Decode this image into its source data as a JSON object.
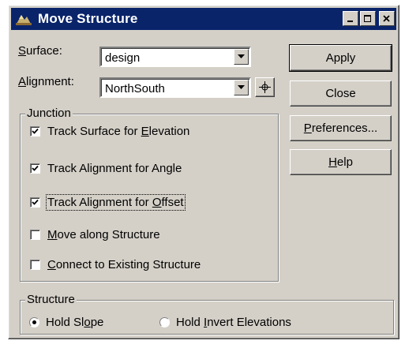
{
  "window": {
    "title": "Move Structure",
    "icon": "app-icon"
  },
  "titlebar_buttons": {
    "minimize": "minimize-icon",
    "maximize": "maximize-icon",
    "close": "close-icon"
  },
  "surface": {
    "label_prefix": "S",
    "label_rest": "urface:",
    "value": "design"
  },
  "alignment": {
    "label_prefix": "A",
    "label_rest": "lignment:",
    "value": "NorthSouth",
    "pick_icon": "crosshair-icon"
  },
  "buttons": {
    "apply": "Apply",
    "close": "Close",
    "preferences_prefix": "P",
    "preferences_rest": "references...",
    "help_prefix": "H",
    "help_rest": "elp"
  },
  "junction": {
    "title": "Junction",
    "options": [
      {
        "pre": "Track Surface for ",
        "u": "E",
        "post": "levation",
        "checked": true
      },
      {
        "pre": "Track Alignment for Angle",
        "u": "",
        "post": "",
        "checked": true
      },
      {
        "pre": "Track Alignment for ",
        "u": "O",
        "post": "ffset",
        "checked": true
      },
      {
        "pre": "",
        "u": "M",
        "post": "ove along Structure",
        "checked": false
      },
      {
        "pre": "",
        "u": "C",
        "post": "onnect to Existing Structure",
        "checked": false
      }
    ]
  },
  "structure": {
    "title": "Structure",
    "hold_slope": {
      "pre": "Hold Sl",
      "u": "o",
      "post": "pe",
      "selected": true
    },
    "hold_invert": {
      "pre": "Hold ",
      "u": "I",
      "post": "nvert Elevations",
      "selected": false
    }
  },
  "colors": {
    "titlebar": "#0a246a",
    "face": "#d4d0c8"
  }
}
